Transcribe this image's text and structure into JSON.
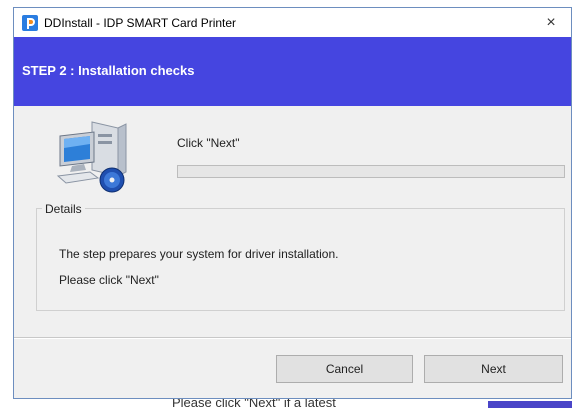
{
  "window": {
    "title": "DDInstall  -  IDP SMART Card Printer",
    "close_glyph": "×"
  },
  "banner": {
    "step_text": "STEP 2 :   Installation checks",
    "background_color": "#4545e0"
  },
  "status": {
    "instruction": "Click \"Next\"",
    "progress": 0
  },
  "details": {
    "legend": "Details",
    "lines": [
      "The step prepares your system for driver installation.",
      "Please click \"Next\""
    ]
  },
  "buttons": {
    "cancel_label": "Cancel",
    "next_label": "Next"
  },
  "background": {
    "text": "Please click \"Next\" if a latest"
  },
  "icons": {
    "app": "idp-logo-icon",
    "close": "close-icon",
    "graphic": "computer-install-icon"
  }
}
